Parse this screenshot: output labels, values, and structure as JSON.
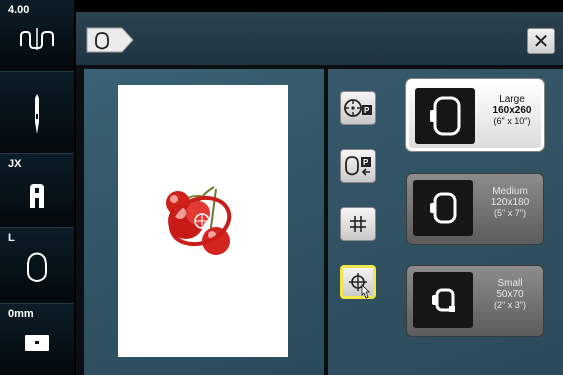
{
  "status_bar": {
    "tension_value": "4.00",
    "presser_foot": "JX",
    "thread_mode": "L",
    "width_value": "0mm"
  },
  "hoop_selection": {
    "close_label": "✕",
    "hoops": [
      {
        "name": "Large",
        "size": "160x260",
        "inches": "(6\" x 10\")",
        "selected": true
      },
      {
        "name": "Medium",
        "size": "120x180",
        "inches": "(5\" x 7\")",
        "selected": false
      },
      {
        "name": "Small",
        "size": "50x70",
        "inches": "(2\" x 3\")",
        "selected": false
      }
    ]
  },
  "colors": {
    "accent_selected": "#f1e64a",
    "panel_bg": "#37596a",
    "design_red": "#d0211c"
  }
}
